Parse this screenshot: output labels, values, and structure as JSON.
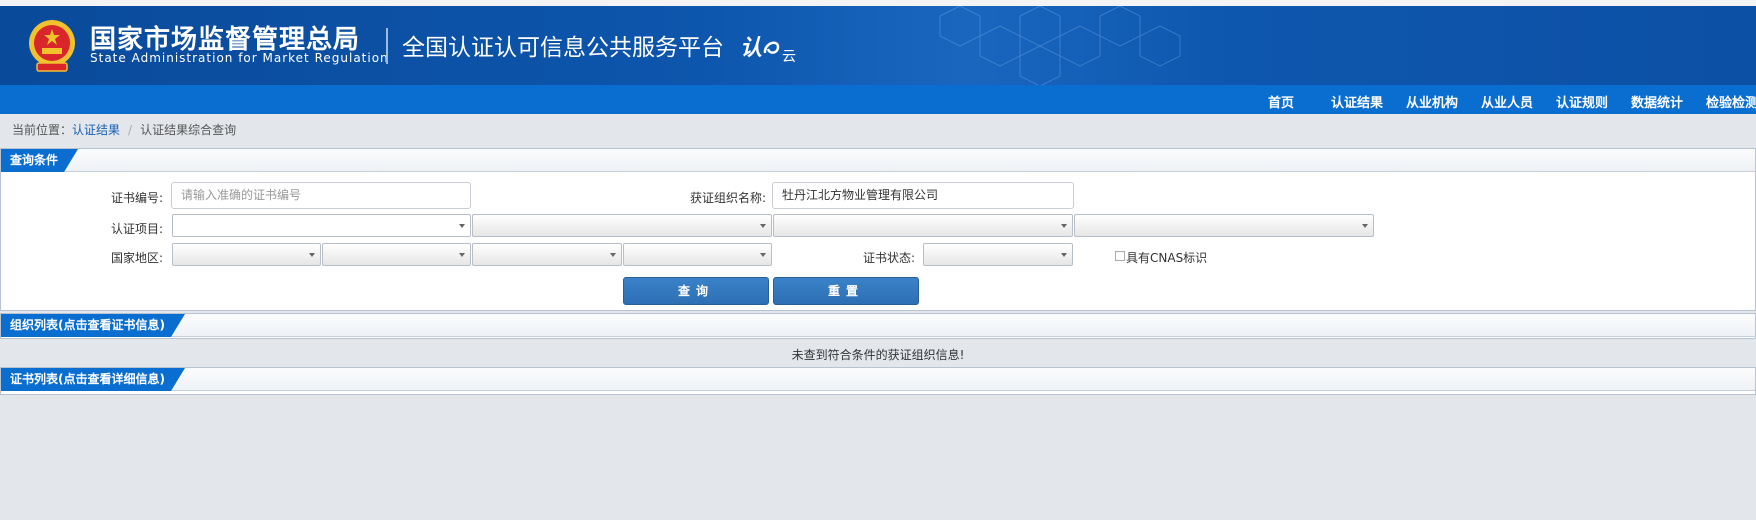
{
  "header": {
    "org_cn": "国家市场监督管理总局",
    "org_en": "State Administration  for  Market Regulation",
    "platform": "全国认证认可信息公共服务平台",
    "logo_text": "认",
    "logo_suffix": "云"
  },
  "nav": {
    "items": [
      "首页",
      "认证结果",
      "从业机构",
      "从业人员",
      "认证规则",
      "数据统计",
      "检验检测"
    ]
  },
  "breadcrumb": {
    "prefix": "当前位置：",
    "link": "认证结果",
    "separator": "/",
    "current": "认证结果综合查询"
  },
  "query_panel": {
    "title": "查询条件",
    "cert_no_label": "证书编号:",
    "cert_no_placeholder": "请输入准确的证书编号",
    "org_name_label": "获证组织名称:",
    "org_name_value": "牡丹江北方物业管理有限公司",
    "cert_item_label": "认证项目:",
    "region_label": "国家地区:",
    "status_label": "证书状态:",
    "cnas_label": "具有CNAS标识",
    "query_button": "查询",
    "reset_button": "重置"
  },
  "org_panel": {
    "title": "组织列表(点击查看证书信息)",
    "empty_message": "未查到符合条件的获证组织信息!"
  },
  "cert_panel": {
    "title": "证书列表(点击查看详细信息)"
  },
  "colors": {
    "header_blue": "#0d56ad",
    "nav_blue": "#0a6ed1",
    "button_blue": "#2d6fb3",
    "page_bg": "#e3e7ec"
  }
}
